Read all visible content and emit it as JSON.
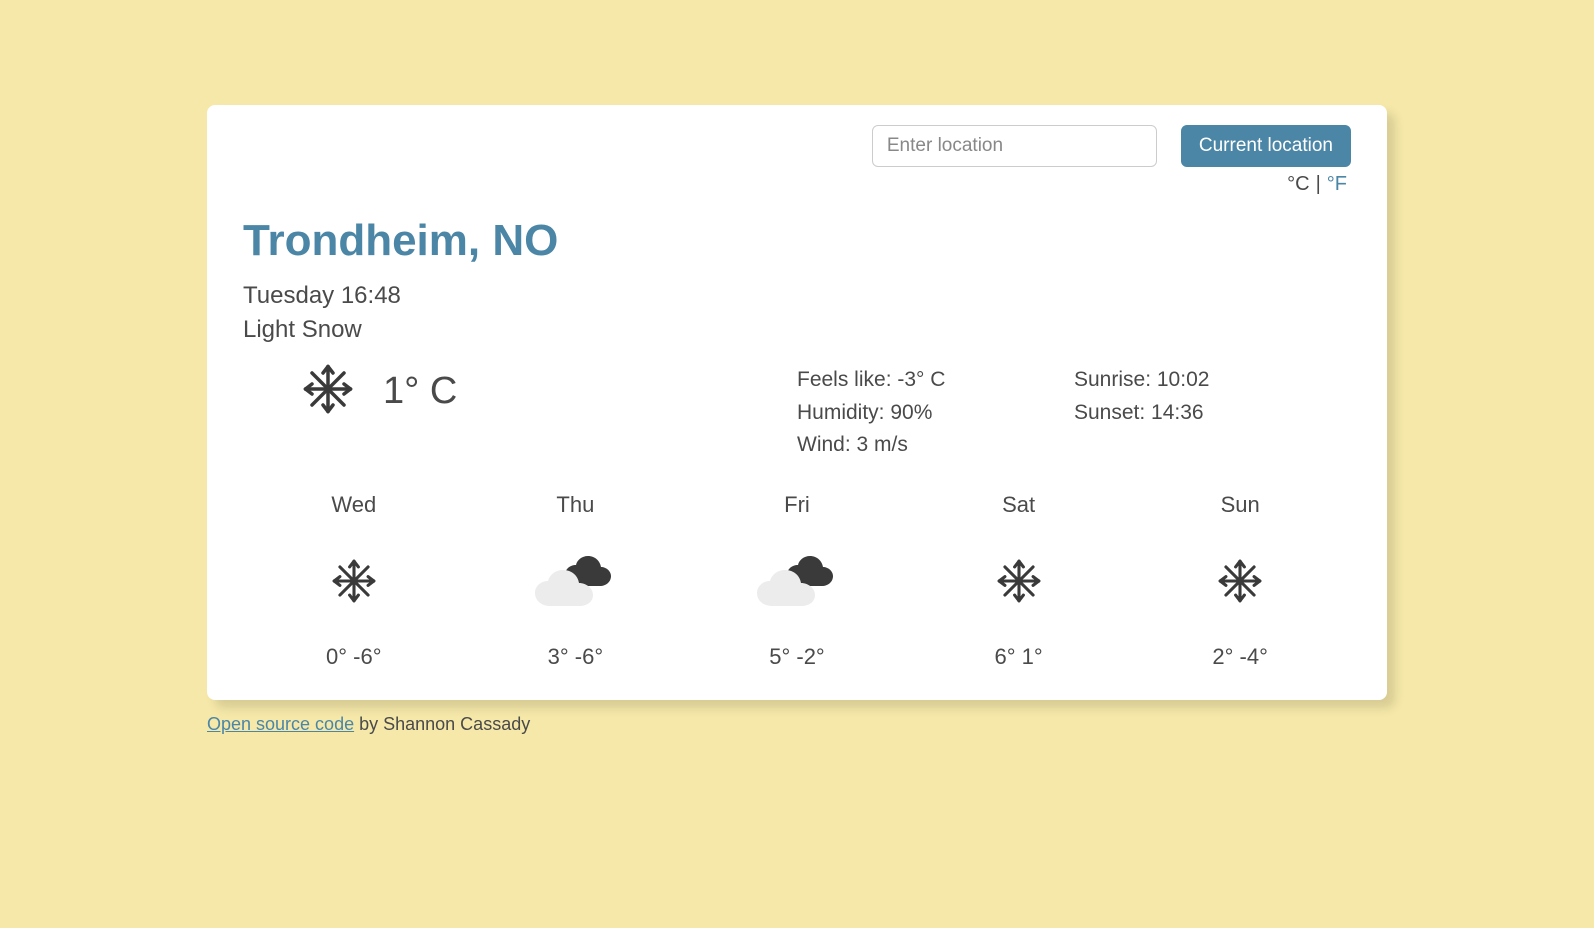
{
  "search": {
    "placeholder": "Enter location",
    "button_label": "Current location"
  },
  "units": {
    "c_label": "°C",
    "f_label": "°F",
    "separator": "|"
  },
  "current": {
    "city": "Trondheim, NO",
    "datetime": "Tuesday 16:48",
    "condition": "Light Snow",
    "icon": "snow",
    "temp_display": "1° C",
    "feels_like": "Feels like: -3° C",
    "humidity": "Humidity: 90%",
    "wind": "Wind: 3 m/s",
    "sunrise": "Sunrise: 10:02",
    "sunset": "Sunset: 14:36"
  },
  "forecast": [
    {
      "day": "Wed",
      "icon": "snow",
      "temps": "0° -6°"
    },
    {
      "day": "Thu",
      "icon": "cloudy",
      "temps": "3° -6°"
    },
    {
      "day": "Fri",
      "icon": "cloudy",
      "temps": "5° -2°"
    },
    {
      "day": "Sat",
      "icon": "snow",
      "temps": "6° 1°"
    },
    {
      "day": "Sun",
      "icon": "snow",
      "temps": "2° -4°"
    }
  ],
  "footer": {
    "link_label": "Open source code",
    "by_label": " by Shannon Cassady"
  }
}
